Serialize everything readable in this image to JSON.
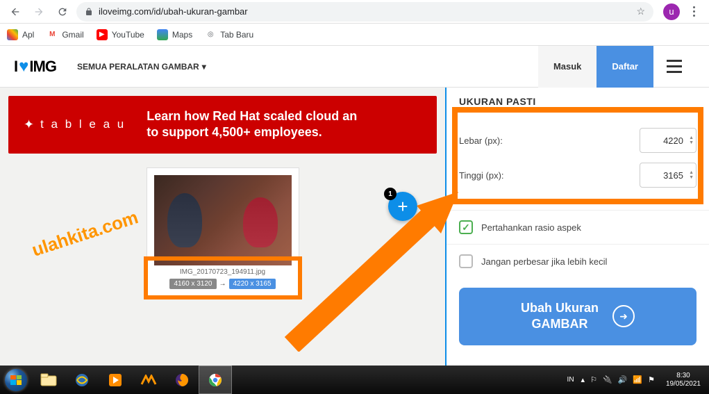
{
  "browser": {
    "url": "iloveimg.com/id/ubah-ukuran-gambar",
    "profile_initial": "u"
  },
  "bookmarks": {
    "apl": "Apl",
    "gmail": "Gmail",
    "youtube": "YouTube",
    "maps": "Maps",
    "tabbaru": "Tab Baru"
  },
  "header": {
    "logo_pre": "I",
    "logo_post": "IMG",
    "menu_label": "SEMUA PERALATAN GAMBAR",
    "masuk": "Masuk",
    "daftar": "Daftar"
  },
  "banner": {
    "brand": "t a b l e a u",
    "line1": "Learn how Red Hat scaled cloud an",
    "line2": "to support 4,500+ employees."
  },
  "image_card": {
    "filename": "IMG_20170723_194911.jpg",
    "old_dims": "4160 x 3120",
    "new_dims": "4220 x 3165",
    "badge_count": "1"
  },
  "watermark": "ulahkita.com",
  "right_pane": {
    "title": "UKURAN PASTI",
    "width_label": "Lebar (px):",
    "width_value": "4220",
    "height_label": "Tinggi (px):",
    "height_value": "3165",
    "aspect_label": "Pertahankan rasio aspek",
    "noupscale_label": "Jangan perbesar jika lebih kecil",
    "action_line1": "Ubah Ukuran",
    "action_line2": "GAMBAR"
  },
  "taskbar": {
    "lang": "IN",
    "time": "8:30",
    "date": "19/05/2021"
  }
}
